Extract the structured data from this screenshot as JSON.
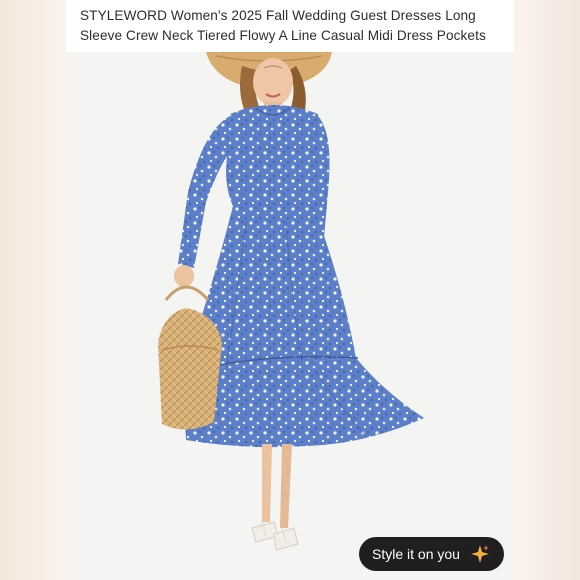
{
  "product": {
    "title": "STYLEWORD Women's 2025 Fall Wedding Guest Dresses Long Sleeve Crew Neck Tiered Flowy A Line Casual Midi Dress Pockets"
  },
  "image": {
    "subject": "model-in-blue-floral-dress",
    "dress_color": "#5b7fc9",
    "background_color": "#f4f4f2"
  },
  "style_button": {
    "label": "Style it on you",
    "icon": "sparkle-icon",
    "background": "#1f1f1f",
    "icon_color": "#f3b13a"
  }
}
